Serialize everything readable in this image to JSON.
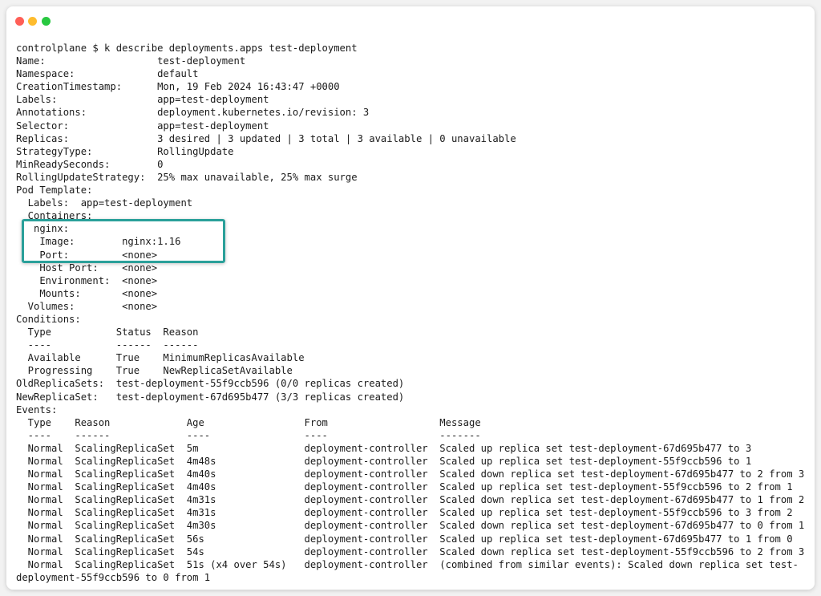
{
  "window": {
    "traffic_lights": [
      "close",
      "minimize",
      "maximize"
    ]
  },
  "highlight": {
    "color": "#2aa09a",
    "label": "nginx container"
  },
  "terminal": {
    "lines": [
      "controlplane $ k describe deployments.apps test-deployment",
      "Name:                   test-deployment",
      "Namespace:              default",
      "CreationTimestamp:      Mon, 19 Feb 2024 16:43:47 +0000",
      "Labels:                 app=test-deployment",
      "Annotations:            deployment.kubernetes.io/revision: 3",
      "Selector:               app=test-deployment",
      "Replicas:               3 desired | 3 updated | 3 total | 3 available | 0 unavailable",
      "StrategyType:           RollingUpdate",
      "MinReadySeconds:        0",
      "RollingUpdateStrategy:  25% max unavailable, 25% max surge",
      "Pod Template:",
      "  Labels:  app=test-deployment",
      "  Containers:",
      "   nginx:",
      "    Image:        nginx:1.16",
      "    Port:         <none>",
      "    Host Port:    <none>",
      "    Environment:  <none>",
      "    Mounts:       <none>",
      "  Volumes:        <none>",
      "Conditions:",
      "  Type           Status  Reason",
      "  ----           ------  ------",
      "  Available      True    MinimumReplicasAvailable",
      "  Progressing    True    NewReplicaSetAvailable",
      "OldReplicaSets:  test-deployment-55f9ccb596 (0/0 replicas created)",
      "NewReplicaSet:   test-deployment-67d695b477 (3/3 replicas created)",
      "Events:",
      "  Type    Reason             Age                 From                   Message",
      "  ----    ------             ----                ----                   -------",
      "  Normal  ScalingReplicaSet  5m                  deployment-controller  Scaled up replica set test-deployment-67d695b477 to 3",
      "  Normal  ScalingReplicaSet  4m48s               deployment-controller  Scaled up replica set test-deployment-55f9ccb596 to 1",
      "  Normal  ScalingReplicaSet  4m40s               deployment-controller  Scaled down replica set test-deployment-67d695b477 to 2 from 3",
      "  Normal  ScalingReplicaSet  4m40s               deployment-controller  Scaled up replica set test-deployment-55f9ccb596 to 2 from 1",
      "  Normal  ScalingReplicaSet  4m31s               deployment-controller  Scaled down replica set test-deployment-67d695b477 to 1 from 2",
      "  Normal  ScalingReplicaSet  4m31s               deployment-controller  Scaled up replica set test-deployment-55f9ccb596 to 3 from 2",
      "  Normal  ScalingReplicaSet  4m30s               deployment-controller  Scaled down replica set test-deployment-67d695b477 to 0 from 1",
      "  Normal  ScalingReplicaSet  56s                 deployment-controller  Scaled up replica set test-deployment-67d695b477 to 1 from 0",
      "  Normal  ScalingReplicaSet  54s                 deployment-controller  Scaled down replica set test-deployment-55f9ccb596 to 2 from 3",
      "  Normal  ScalingReplicaSet  51s (x4 over 54s)   deployment-controller  (combined from similar events): Scaled down replica set test-",
      "deployment-55f9ccb596 to 0 from 1"
    ]
  }
}
